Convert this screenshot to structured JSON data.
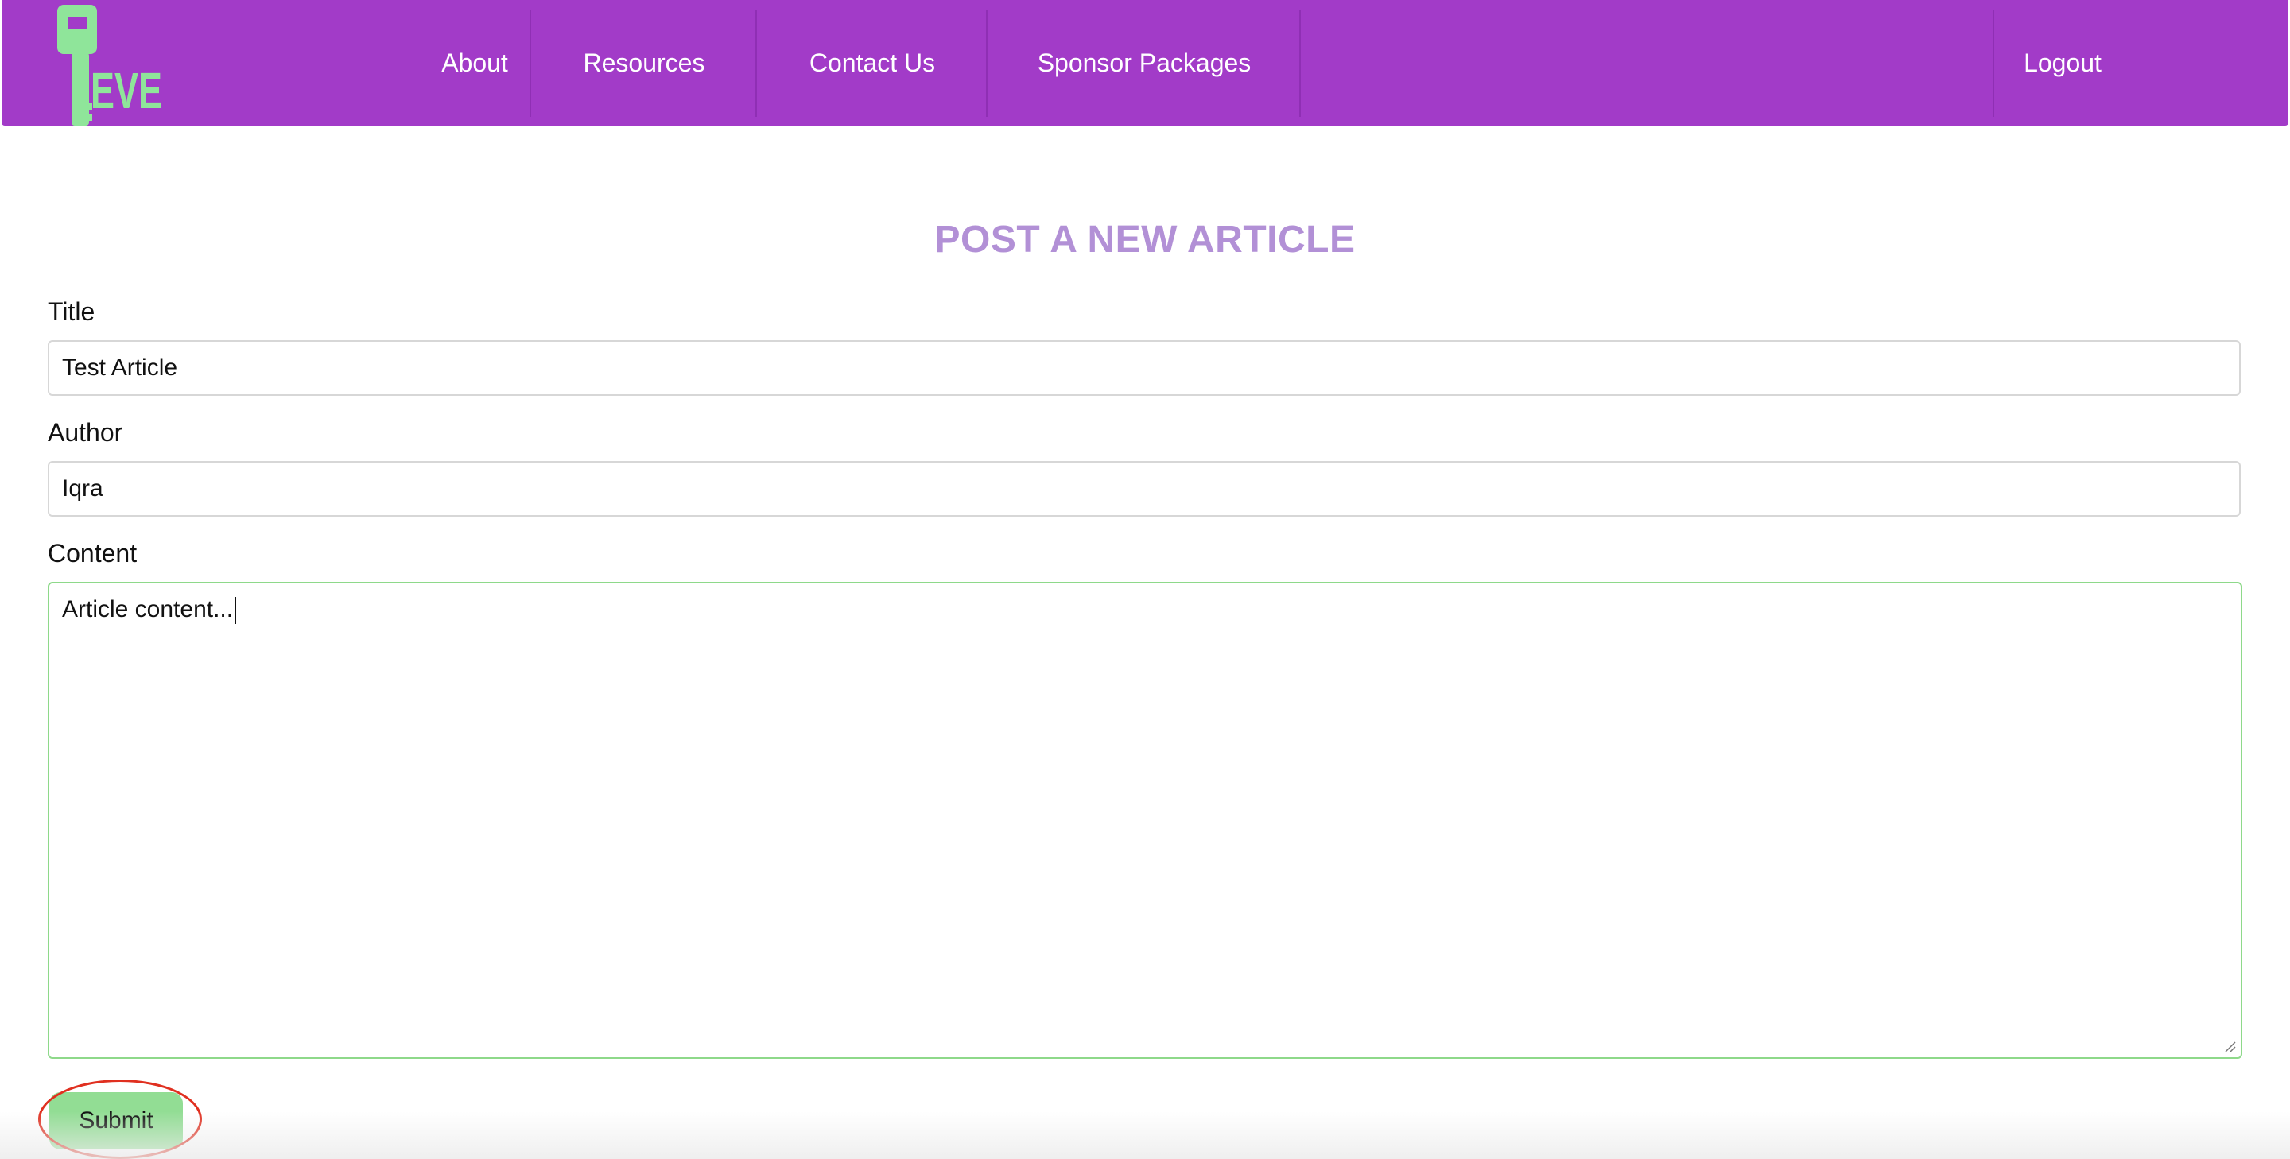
{
  "brand": {
    "logo_icon": "key-icon",
    "logo_text": "EVE",
    "colors": {
      "navbar": "#a23bc8",
      "logo": "#8fe59a",
      "heading": "#b290d6",
      "submit": "#92dd94",
      "focus_border": "#8ed98a"
    }
  },
  "nav": {
    "items": [
      {
        "label": "About"
      },
      {
        "label": "Resources"
      },
      {
        "label": "Contact Us"
      },
      {
        "label": "Sponsor Packages"
      }
    ],
    "logout_label": "Logout"
  },
  "form": {
    "heading": "POST A NEW ARTICLE",
    "title_label": "Title",
    "title_value": "Test Article",
    "author_label": "Author",
    "author_value": "Iqra",
    "content_label": "Content",
    "content_value": "Article content...",
    "submit_label": "Submit"
  }
}
